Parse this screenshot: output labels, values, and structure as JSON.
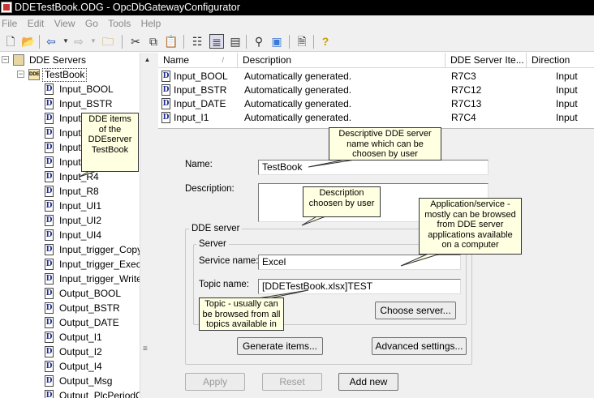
{
  "window": {
    "title": "DDETestBook.ODG - OpcDbGatewayConfigurator"
  },
  "menu": [
    "File",
    "Edit",
    "View",
    "Go",
    "Tools",
    "Help"
  ],
  "toolbar": {
    "icons": [
      "new-icon",
      "open-icon",
      "back-icon",
      "back-dropdown-icon",
      "forward-icon",
      "forward-dropdown-icon",
      "folder-up-icon",
      "cut-icon",
      "copy-icon",
      "paste-icon",
      "list-view-icon",
      "details-view-icon",
      "large-icons-view-icon",
      "find-icon",
      "preview-icon",
      "properties-icon",
      "help-icon"
    ]
  },
  "tree": {
    "root": "DDE Servers",
    "server": "TestBook",
    "items": [
      "Input_BOOL",
      "Input_BSTR",
      "Input_DATE",
      "Input_I1",
      "Input_I2",
      "Input_I4",
      "Input_R4",
      "Input_R8",
      "Input_UI1",
      "Input_UI2",
      "Input_UI4",
      "Input_trigger_Copy",
      "Input_trigger_Exec",
      "Input_trigger_Write",
      "Output_BOOL",
      "Output_BSTR",
      "Output_DATE",
      "Output_I1",
      "Output_I2",
      "Output_I4",
      "Output_Msg",
      "Output_PlcPeriodC"
    ],
    "visible_labels": [
      "Input_BOOL",
      "Input_BSTR",
      "Input",
      "Input",
      "Input",
      "Input",
      "Input_R4",
      "Input_R8",
      "Input_UI1",
      "Input_UI2",
      "Input_UI4",
      "Input_trigger_Copy",
      "Input_trigger_Exec",
      "Input_trigger_Write",
      "Output_BOOL",
      "Output_BSTR",
      "Output_DATE",
      "Output_I1",
      "Output_I2",
      "Output_I4",
      "Output_Msg",
      "Output_PlcPeriodC"
    ]
  },
  "list": {
    "columns": [
      "Name",
      "Description",
      "DDE Server Ite...",
      "Direction"
    ],
    "sort_mark": "/",
    "rows": [
      {
        "name": "Input_BOOL",
        "description": "Automatically generated.",
        "item": "R7C3",
        "direction": "Input"
      },
      {
        "name": "Input_BSTR",
        "description": "Automatically generated.",
        "item": "R7C12",
        "direction": "Input"
      },
      {
        "name": "Input_DATE",
        "description": "Automatically generated.",
        "item": "R7C13",
        "direction": "Input"
      },
      {
        "name": "Input_I1",
        "description": "Automatically generated.",
        "item": "R7C4",
        "direction": "Input"
      }
    ]
  },
  "detail": {
    "name_label": "Name:",
    "name_value": "TestBook",
    "description_label": "Description:",
    "description_value": "",
    "dde_group_title": "DDE server",
    "server_group_title": "Server",
    "service_label": "Service name:",
    "service_value": "Excel",
    "topic_label": "Topic name:",
    "topic_value": "[DDETestBook.xlsx]TEST",
    "choose_server_button": "Choose server...",
    "generate_items_button": "Generate items...",
    "advanced_settings_button": "Advanced settings...",
    "apply_button": "Apply",
    "reset_button": "Reset",
    "add_new_button": "Add new"
  },
  "callouts": {
    "dde_items": "DDE items of the DDEserver TestBook",
    "descriptive_name": "Descriptive DDE server name which can be choosen by user",
    "description": "Description choosen by user",
    "application": "Application/service - mostly can be browsed from DDE server applications available on a computer",
    "topic": "Topic - usually can be browsed from all topics available in"
  },
  "colors": {
    "tooltip_bg": "#ffffe1",
    "doc_icon_letter": "#1a2a88",
    "title_bar": "#000000"
  }
}
